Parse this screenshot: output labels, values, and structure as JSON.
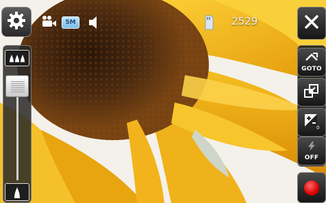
{
  "status_bar": {
    "mode_icon": "video-camera-icon",
    "resolution": "5M",
    "sound_icon": "speaker-icon",
    "storage_icon": "memory-card-icon",
    "remaining_count": "2529"
  },
  "left_bar": {
    "settings_icon": "gear-icon",
    "zoom_in_icon": "zoom-in-icon",
    "zoom_out_icon": "zoom-out-icon",
    "zoom_level": 0.95
  },
  "right_bar": {
    "close_icon": "close-icon",
    "goto_label": "GOTO",
    "scene_icon": "scene-icon",
    "exposure_icon": "exposure-icon",
    "flash_label": "OFF",
    "record_icon": "record-icon"
  },
  "colors": {
    "record": "#e00000",
    "flower_petal": "#f2b51a",
    "flower_center": "#4a2a10"
  }
}
